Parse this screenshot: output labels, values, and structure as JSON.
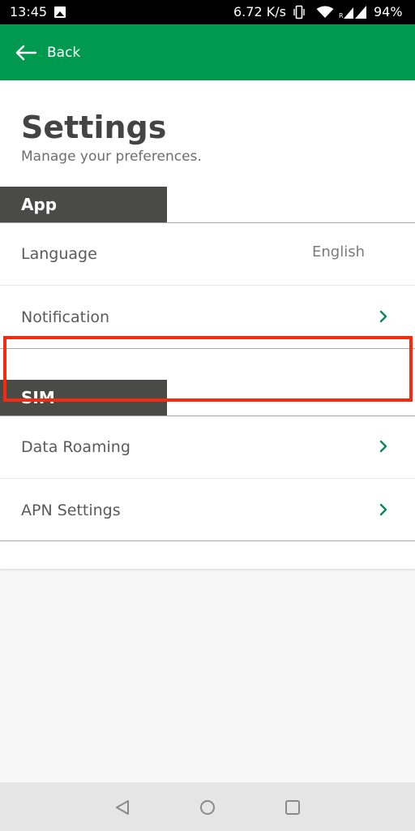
{
  "status_bar": {
    "time": "13:45",
    "speed": "6.72 K/s",
    "battery": "94%"
  },
  "app_bar": {
    "back_label": "Back",
    "color": "#009a4e"
  },
  "page": {
    "title": "Settings",
    "subtitle": "Manage your preferences."
  },
  "sections": [
    {
      "header": "App",
      "items": [
        {
          "label": "Language",
          "value": "English"
        },
        {
          "label": "Notification"
        }
      ]
    },
    {
      "header": "SIM",
      "items": [
        {
          "label": "Data Roaming",
          "highlighted": true
        },
        {
          "label": "APN Settings"
        }
      ]
    }
  ],
  "icons": {
    "back": "arrow-left-icon",
    "chevron": "chevron-right-icon",
    "nav_back": "triangle-back-icon",
    "nav_home": "circle-home-icon",
    "nav_recents": "square-recents-icon"
  },
  "colors": {
    "accent": "#009a4e",
    "section_header_bg": "#4a4a47",
    "highlight": "#f72a10"
  }
}
